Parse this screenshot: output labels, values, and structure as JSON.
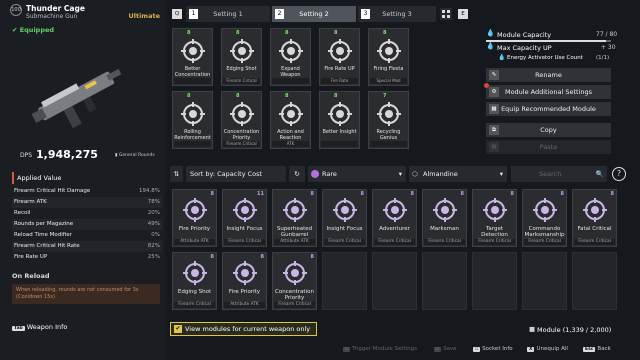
{
  "weapon": {
    "level": "100",
    "name": "Thunder Cage",
    "type": "Submachine Gun",
    "rarity": "Ultimate",
    "equipped": "Equipped",
    "dps_label": "DPS",
    "dps_value": "1,948,275",
    "ammo": "General Rounds"
  },
  "stats": {
    "header": "Applied Value",
    "rows": [
      {
        "name": "Firearm Critical Hit Damage",
        "value": "194.8%"
      },
      {
        "name": "Firearm ATK",
        "value": "78%"
      },
      {
        "name": "Recoil",
        "value": "20%"
      },
      {
        "name": "Rounds per Magazine",
        "value": "49%"
      },
      {
        "name": "Reload Time Modifier",
        "value": "0%"
      },
      {
        "name": "Firearm Critical Hit Rate",
        "value": "82%"
      },
      {
        "name": "Fire Rate UP",
        "value": "25%"
      }
    ]
  },
  "on_reload": {
    "header": "On Reload",
    "text": "When reloading, rounds are not consumed for 3s (Cooldown 15s)"
  },
  "weapon_info": {
    "key": "Tab",
    "label": "Weapon Info"
  },
  "tabs": {
    "left_key": "Q",
    "right_key": "E",
    "items": [
      {
        "num": "1",
        "label": "Setting 1"
      },
      {
        "num": "2",
        "label": "Setting 2"
      },
      {
        "num": "3",
        "label": "Setting 3"
      }
    ]
  },
  "equipped_modules": [
    {
      "cost": "8",
      "name": "Better Concentration",
      "sub": ""
    },
    {
      "cost": "8",
      "name": "Edging Shot",
      "sub": "Firearm Critical"
    },
    {
      "cost": "8",
      "name": "Expand Weapon Charge",
      "sub": ""
    },
    {
      "cost": "8",
      "name": "Fire Rate UP",
      "sub": "Fire Rate"
    },
    {
      "cost": "8",
      "name": "Firing Fiesta",
      "sub": "Special Mod"
    },
    {
      "cost": "8",
      "name": "Rolling Reinforcement",
      "sub": ""
    },
    {
      "cost": "8",
      "name": "Concentration Priority",
      "sub": "Firearm Critical"
    },
    {
      "cost": "8",
      "name": "Action and Reaction",
      "sub": "ATK"
    },
    {
      "cost": "8",
      "name": "Better Insight",
      "sub": ""
    },
    {
      "cost": "7",
      "name": "Recycling Genius",
      "sub": ""
    }
  ],
  "capacity": {
    "label": "Module Capacity",
    "value": "77 / 80",
    "max_label": "Max Capacity UP",
    "max_value": "+ 30",
    "activator_label": "Energy Activator Use Count",
    "activator_value": "(1/1)"
  },
  "buttons": {
    "rename": "Rename",
    "additional": "Module Additional Settings",
    "recommended": "Equip Recommended Module",
    "copy": "Copy",
    "paste": "Paste"
  },
  "filters": {
    "sort": "Sort by: Capacity Cost",
    "rarity": "Rare",
    "socket": "Almandine",
    "search_placeholder": "Search"
  },
  "inventory": [
    {
      "cost": "8",
      "name": "Fire Priority",
      "sub": "Attribute ATK"
    },
    {
      "cost": "11",
      "name": "Insight Focus",
      "sub": "Firearm Critical"
    },
    {
      "cost": "8",
      "name": "Superheated Gunbarrel",
      "sub": "Attribute ATK"
    },
    {
      "cost": "8",
      "name": "Insight Focus",
      "sub": "Firearm Critical"
    },
    {
      "cost": "8",
      "name": "Adventurer",
      "sub": "Firearm Critical"
    },
    {
      "cost": "8",
      "name": "Marksman",
      "sub": "Firearm Critical"
    },
    {
      "cost": "8",
      "name": "Target Detection",
      "sub": "Firearm Critical"
    },
    {
      "cost": "8",
      "name": "Commando Marksmanship",
      "sub": "Firearm Critical"
    },
    {
      "cost": "8",
      "name": "Fatal Critical",
      "sub": "Firearm Critical"
    },
    {
      "cost": "8",
      "name": "Edging Shot",
      "sub": "Firearm Critical"
    },
    {
      "cost": "8",
      "name": "Fire Priority",
      "sub": "Attribute ATK"
    },
    {
      "cost": "8",
      "name": "Concentration Priority",
      "sub": "Firearm Critical"
    }
  ],
  "view_modules": "View modules for current weapon only",
  "module_count": "Module (1,339 / 2,000)",
  "footer": {
    "trigger": "Trigger Module Settings",
    "save": "Save",
    "socket": "Socket Info",
    "unequip": "Unequip All",
    "back": "Back"
  },
  "colors": {
    "accent": "#5fd46a",
    "rarity_ultimate": "#d8b24a",
    "rarity_rare": "#b070e0"
  }
}
